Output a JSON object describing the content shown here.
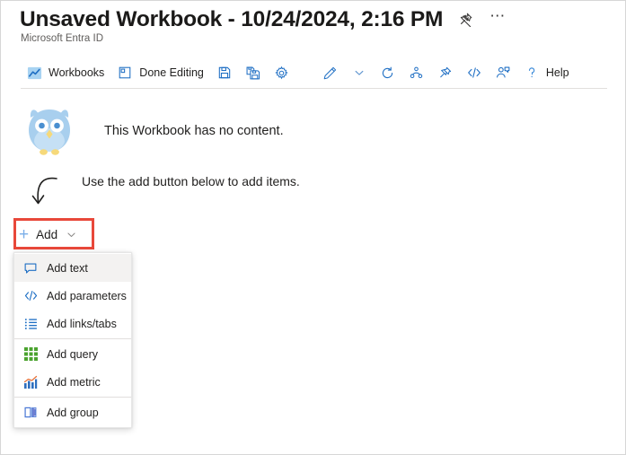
{
  "header": {
    "title": "Unsaved Workbook - 10/24/2024, 2:16 PM",
    "subtitle": "Microsoft Entra ID",
    "pin_icon": "pin-icon",
    "more_label": "⋯"
  },
  "toolbar": {
    "items": [
      {
        "label": "Workbooks",
        "icon": "workbooks-chart-icon",
        "name": "toolbar-workbooks"
      },
      {
        "label": "Done Editing",
        "icon": "done-editing-icon",
        "name": "toolbar-done-editing"
      },
      {
        "label": "",
        "icon": "save-icon",
        "name": "toolbar-save"
      },
      {
        "label": "",
        "icon": "save-as-icon",
        "name": "toolbar-save-as"
      },
      {
        "label": "",
        "icon": "gear-icon",
        "name": "toolbar-settings"
      },
      {
        "label": "",
        "icon": "pencil-edit-icon",
        "name": "toolbar-edit"
      },
      {
        "label": "",
        "icon": "chevron-down-icon",
        "name": "toolbar-edit-chevron"
      },
      {
        "label": "",
        "icon": "refresh-icon",
        "name": "toolbar-refresh"
      },
      {
        "label": "",
        "icon": "share-icon",
        "name": "toolbar-share"
      },
      {
        "label": "",
        "icon": "pin-icon",
        "name": "toolbar-pin"
      },
      {
        "label": "",
        "icon": "code-icon",
        "name": "toolbar-code"
      },
      {
        "label": "",
        "icon": "feedback-person-icon",
        "name": "toolbar-feedback"
      },
      {
        "label": "Help",
        "icon": "question-mark-icon",
        "name": "toolbar-help"
      }
    ]
  },
  "empty_state": {
    "illustration": "owl-illustration",
    "message": "This Workbook has no content.",
    "hint": "Use the add button below to add items.",
    "hint_arrow": "curved-down-arrow-icon"
  },
  "add_button": {
    "plus": "+",
    "label": "Add",
    "chevron": "chevron-down-icon"
  },
  "menu": {
    "items": [
      {
        "label": "Add text",
        "icon": "speech-bubble-icon",
        "name": "menu-item-add-text",
        "highlighted": true
      },
      {
        "label": "Add parameters",
        "icon": "code-icon",
        "name": "menu-item-add-parameters"
      },
      {
        "label": "Add links/tabs",
        "icon": "list-icon",
        "name": "menu-item-add-links-tabs"
      },
      {
        "label": "Add query",
        "icon": "grid-icon",
        "name": "menu-item-add-query"
      },
      {
        "label": "Add metric",
        "icon": "metric-chart-icon",
        "name": "menu-item-add-metric"
      },
      {
        "label": "Add group",
        "icon": "group-box-icon",
        "name": "menu-item-add-group"
      }
    ]
  },
  "colors": {
    "accent_blue": "#0f6cbd",
    "annotation_red": "#e8483a",
    "owl_body": "#a8cdec",
    "owl_light": "#c8e0f4",
    "owl_beak": "#f6d97a",
    "query_green": "#4ba32f",
    "group_purple": "#6f7fd1",
    "plus_blue": "#7aaee8"
  }
}
